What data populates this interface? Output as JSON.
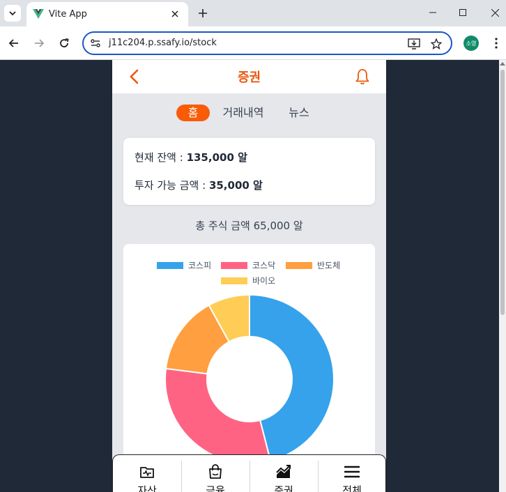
{
  "browser": {
    "tab_title": "Vite App",
    "url": "j11c204.p.ssafy.io/stock",
    "profile_initials": "소영"
  },
  "app": {
    "header_title": "증권",
    "subtabs": [
      {
        "label": "홈",
        "active": true
      },
      {
        "label": "거래내역",
        "active": false
      },
      {
        "label": "뉴스",
        "active": false
      }
    ],
    "balance": {
      "current_label": "현재 잔액 : ",
      "current_value": "135,000 알",
      "available_label": "투자 가능 금액 : ",
      "available_value": "35,000 알"
    },
    "total_stock": "총 주식 금액 65,000 알",
    "bottom_nav": [
      {
        "label": "자산",
        "icon": "wallet-icon"
      },
      {
        "label": "금융",
        "icon": "shopping-bag-icon"
      },
      {
        "label": "증권",
        "icon": "trend-chart-icon"
      },
      {
        "label": "전체",
        "icon": "hamburger-menu-icon"
      }
    ]
  },
  "colors": {
    "accent": "#f95b07",
    "kospi": "#36a2eb",
    "kosdaq": "#ff6384",
    "semiconductor": "#ff9f40",
    "bio": "#ffcd56"
  },
  "chart_data": {
    "type": "pie",
    "variant": "doughnut",
    "categories": [
      "코스피",
      "코스닥",
      "반도체",
      "바이오"
    ],
    "values": [
      46,
      31,
      15,
      8
    ],
    "colors": [
      "#36a2eb",
      "#ff6384",
      "#ff9f40",
      "#ffcd56"
    ],
    "legend": "top"
  }
}
